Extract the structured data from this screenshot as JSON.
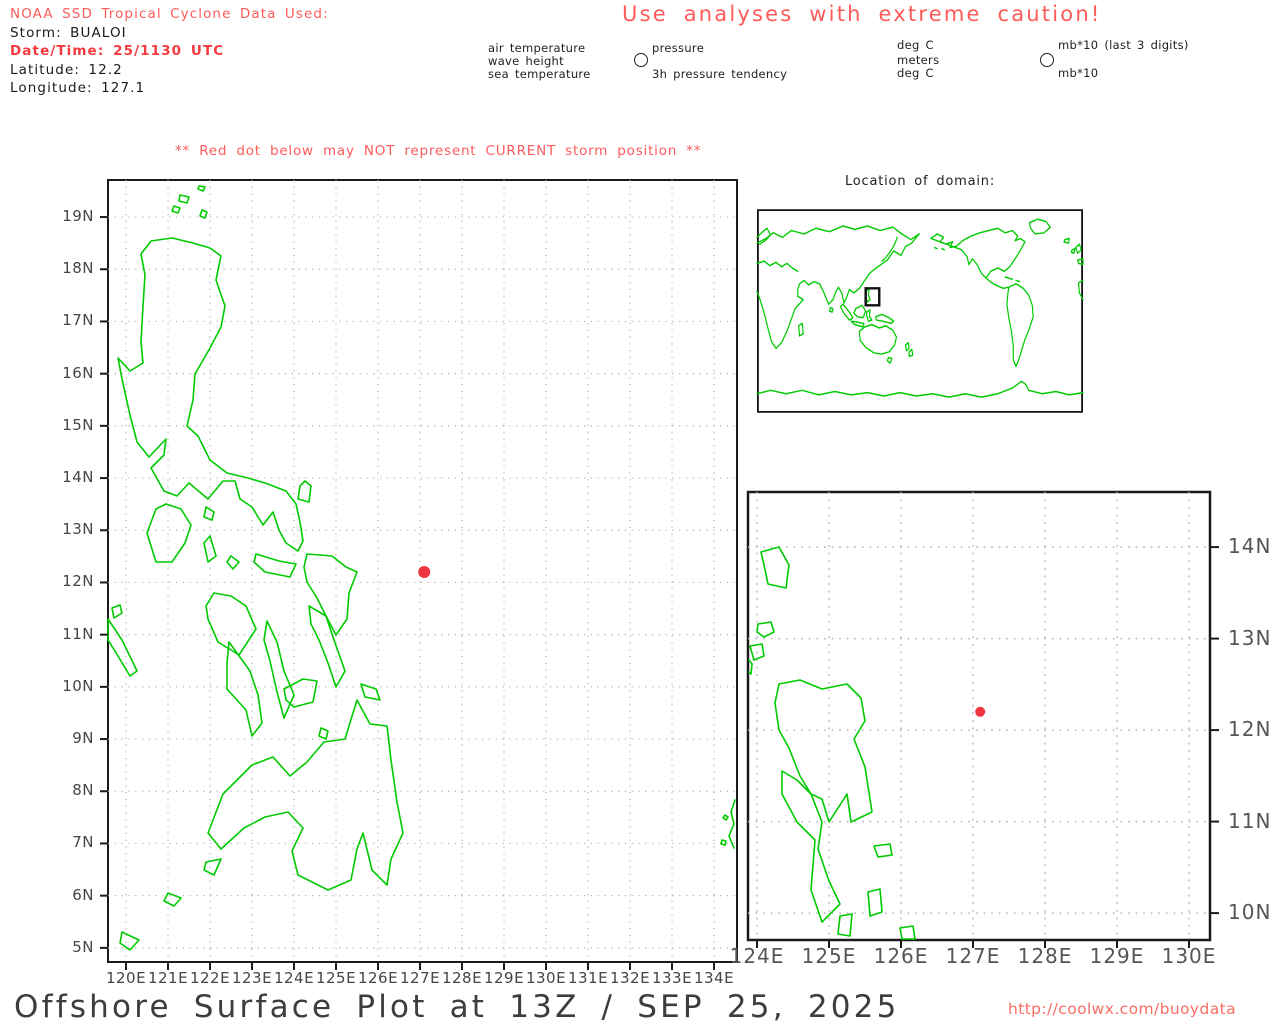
{
  "header": {
    "source_line": "NOAA SSD Tropical Cyclone Data Used:",
    "storm_line": "Storm: BUALOI",
    "datetime_line": "Date/Time: 25/1130 UTC",
    "latitude_line": "Latitude: 12.2",
    "longitude_line": "Longitude: 127.1"
  },
  "caution": "Use analyses with extreme caution!",
  "station_model_legend": {
    "parameters": {
      "top_left": "air temperature",
      "mid_left": "wave height",
      "bottom_left": "sea temperature",
      "top_right": "pressure",
      "bottom_right": "3h pressure tendency"
    },
    "units": {
      "top_left": "deg C",
      "mid_left": "meters",
      "bottom_left": "deg C",
      "top_right": "mb*10 (last 3 digits)",
      "bottom_right": "mb*10"
    }
  },
  "warning": "** Red dot below may NOT represent CURRENT storm position **",
  "inset": {
    "title": "Location of domain:"
  },
  "footer": {
    "title": "Offshore Surface Plot at 13Z / SEP 25, 2025",
    "url": "http://coolwx.com/buoydata"
  },
  "colors": {
    "coastline_green": "#00cb00",
    "alert_red": "#ff5a5a",
    "alert_red_bold": "#f5393d",
    "storm_dot_red": "#ee3540",
    "grid_gray": "#b5b5b5"
  },
  "chart_data": [
    {
      "type": "map",
      "name": "main-surface-map",
      "region": "Philippines and surrounding seas",
      "x_axis": {
        "ticks": [
          "120E",
          "121E",
          "122E",
          "123E",
          "124E",
          "125E",
          "126E",
          "127E",
          "128E",
          "129E",
          "130E",
          "131E",
          "132E",
          "133E",
          "134E"
        ],
        "range_deg_east": [
          119.57,
          134.55
        ]
      },
      "y_axis": {
        "ticks": [
          "19N",
          "18N",
          "17N",
          "16N",
          "15N",
          "14N",
          "13N",
          "12N",
          "11N",
          "10N",
          "9N",
          "8N",
          "7N",
          "6N",
          "5N"
        ],
        "range_deg_north": [
          4.73,
          19.71
        ]
      },
      "grid": "dotted",
      "points": [
        {
          "name": "storm-position",
          "lon": 127.1,
          "lat": 12.2,
          "color": "#ee3540"
        }
      ]
    },
    {
      "type": "map",
      "name": "domain-locator-world-map",
      "title": "Location of domain:",
      "projection": "pacific-centered cylindrical, lon 0-360E, lat 90N-90S",
      "domain_box": {
        "lon_min": 120,
        "lon_max": 135,
        "lat_min": 5,
        "lat_max": 20
      }
    },
    {
      "type": "map",
      "name": "zoom-surface-map",
      "region": "Samar / Leyte and storm vicinity",
      "x_axis": {
        "ticks": [
          "124E",
          "125E",
          "126E",
          "127E",
          "128E",
          "129E",
          "130E"
        ],
        "range_deg_east": [
          123.88,
          130.29
        ]
      },
      "y_axis": {
        "ticks": [
          "14N",
          "13N",
          "12N",
          "11N",
          "10N"
        ],
        "range_deg_north": [
          9.7,
          14.6
        ]
      },
      "grid": "dotted",
      "points": [
        {
          "name": "storm-position",
          "lon": 127.1,
          "lat": 12.2,
          "color": "#ee3540"
        }
      ]
    }
  ]
}
